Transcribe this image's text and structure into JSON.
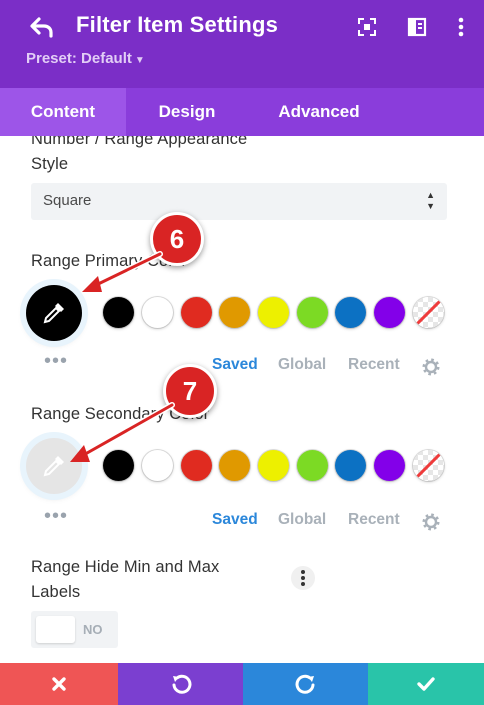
{
  "header": {
    "title": "Filter Item Settings",
    "preset_label": "Preset: Default",
    "icons": [
      "undo-arrow-icon",
      "fullscreen-icon",
      "split-view-icon",
      "more-vertical-icon"
    ],
    "background": "#7b2ec7"
  },
  "tabs": [
    {
      "label": "Content",
      "active": true
    },
    {
      "label": "Design",
      "active": false
    },
    {
      "label": "Advanced",
      "active": false
    }
  ],
  "appearance": {
    "label": "Number / Range Appearance Style",
    "select_value": "Square"
  },
  "primary_color": {
    "label": "Range Primary Color",
    "current": "#000000",
    "annotation": "6"
  },
  "secondary_color": {
    "label": "Range Secondary Color",
    "current": "#e5e5e5",
    "annotation": "7"
  },
  "palette": [
    "#000000",
    "#ffffff",
    "#e02b20",
    "#e09900",
    "#edf000",
    "#7cda24",
    "#0c71c3",
    "#8300e9"
  ],
  "palette_modes": {
    "saved": "Saved",
    "global": "Global",
    "recent": "Recent"
  },
  "more_dots": "•••",
  "hide_labels": {
    "label": "Range Hide Min and Max Labels",
    "toggle_text": "NO"
  },
  "footer": {
    "buttons": [
      {
        "name": "discard-button",
        "icon": "close-icon",
        "color": "#ef5555"
      },
      {
        "name": "undo-button",
        "icon": "undo-icon",
        "color": "#7b3fd0"
      },
      {
        "name": "redo-button",
        "icon": "redo-icon",
        "color": "#2b87da"
      },
      {
        "name": "save-button",
        "icon": "checkmark-icon",
        "color": "#29c4a9"
      }
    ]
  }
}
